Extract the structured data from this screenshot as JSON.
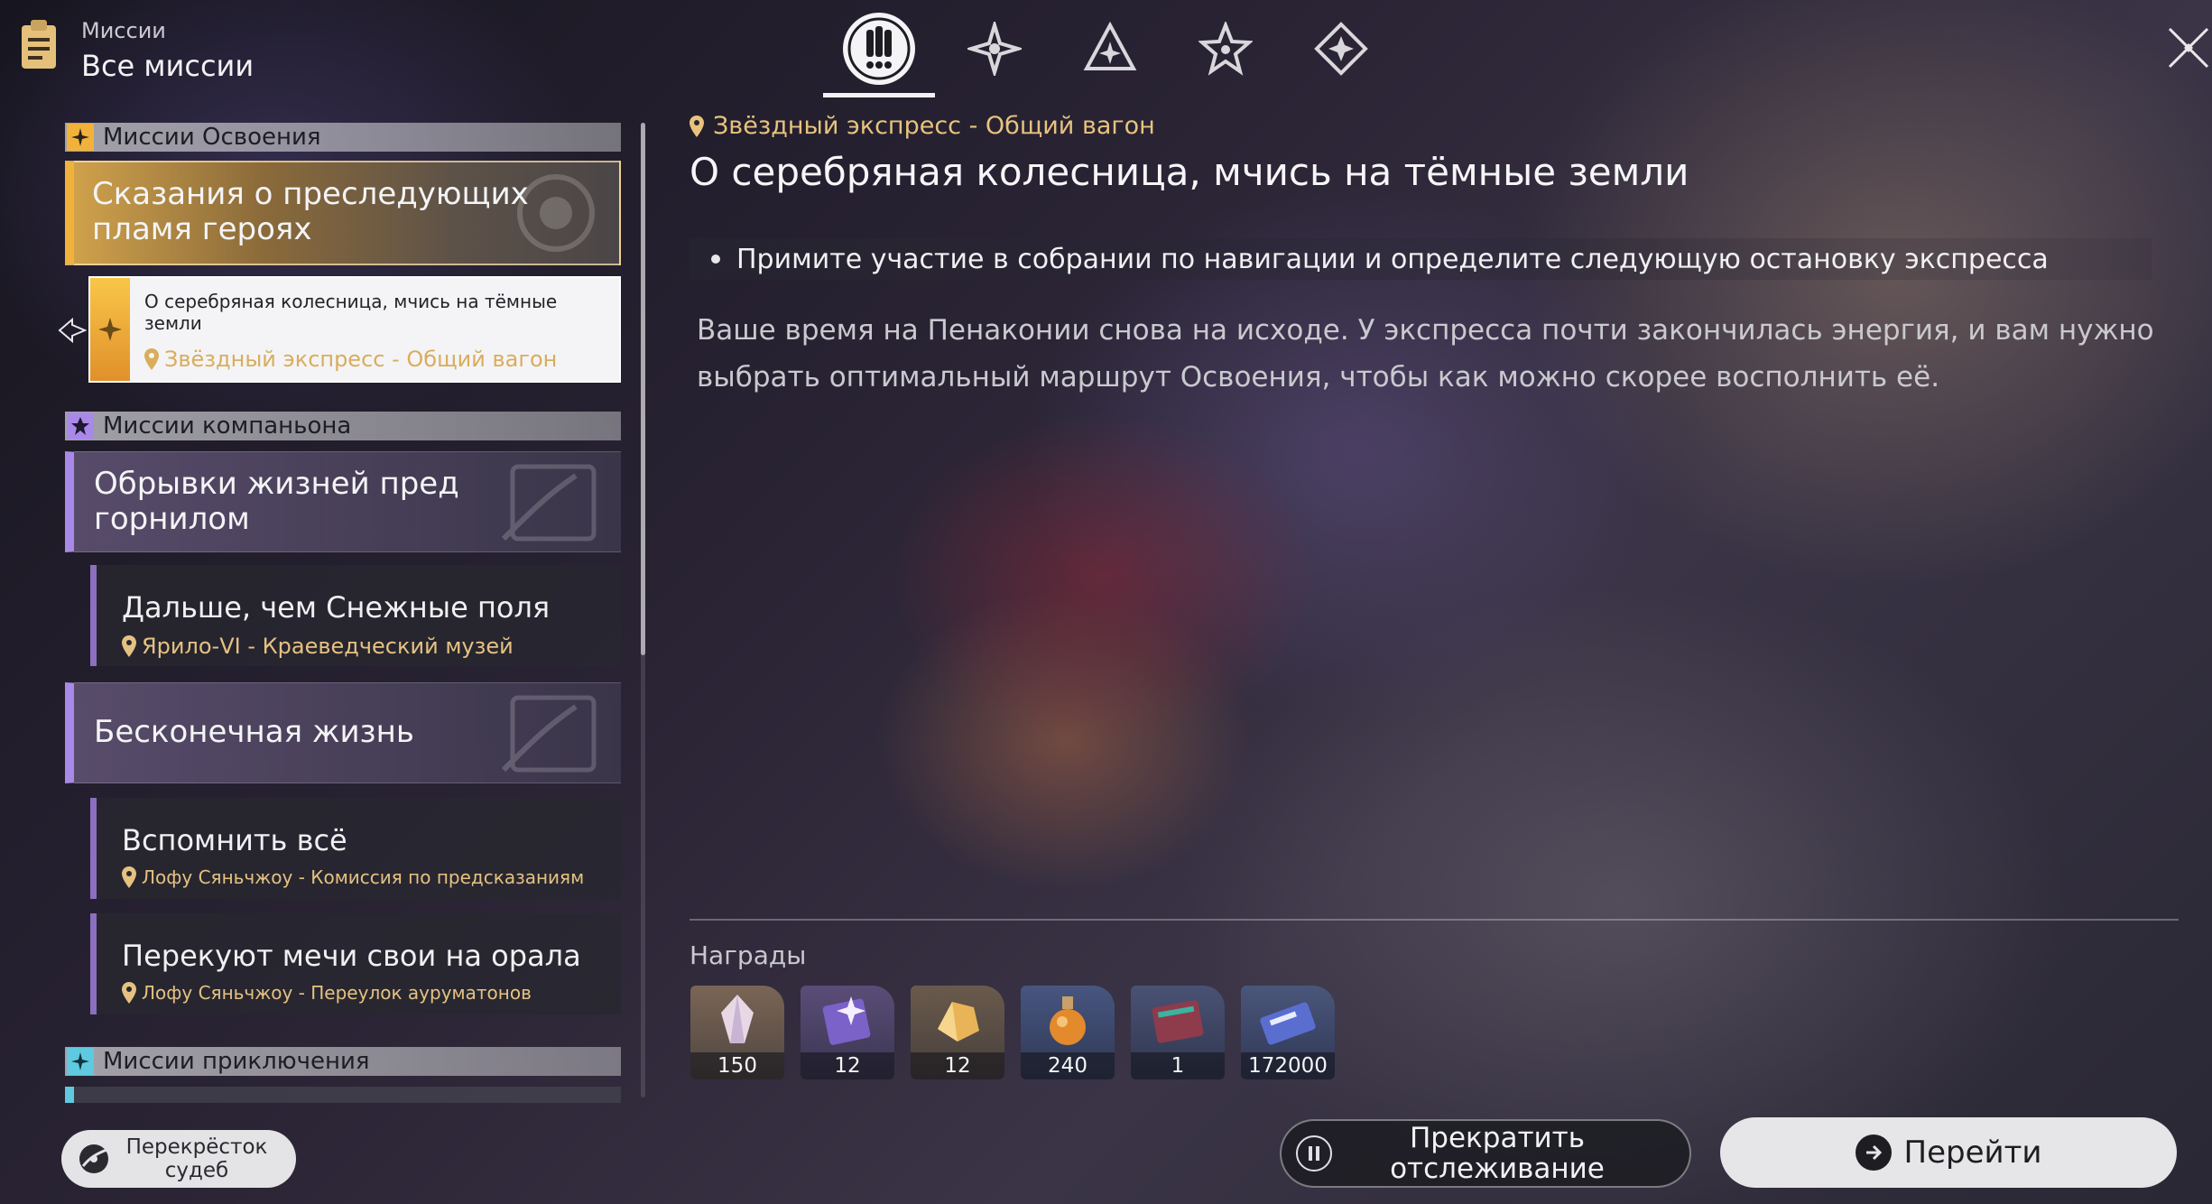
{
  "header": {
    "category": "Миссии",
    "title": "Все миссии",
    "tab_icons": [
      "exclamation-icon",
      "compass-star-icon",
      "triangle-star-icon",
      "five-point-star-icon",
      "diamond-star-icon"
    ],
    "active_tab": 0
  },
  "sidebar": {
    "sections": [
      {
        "label": "Миссии Освоения",
        "color": "#f1b23c"
      },
      {
        "label": "Миссии компаньона",
        "color": "#a989e8"
      },
      {
        "label": "Миссии приключения",
        "color": "#5fc9e0"
      }
    ],
    "trailblaze": {
      "title": "Сказания о преследующих пламя героях",
      "sub": {
        "title": "О серебряная колесница, мчись на тёмные земли",
        "location": "Звёздный экспресс - Общий вагон"
      }
    },
    "companion": [
      {
        "title": "Обрывки жизней пред горнилом",
        "subs": [
          {
            "title": "Дальше, чем Снежные поля",
            "location": "Ярило-VI - Краеведческий музей"
          }
        ]
      },
      {
        "title": "Бесконечная жизнь",
        "subs": [
          {
            "title": "Вспомнить всё",
            "location": "Лофу Сяньчжоу - Комиссия по предсказаниям"
          },
          {
            "title": "Перекуют мечи свои на орала",
            "location": "Лофу Сяньчжоу - Переулок аурума­тонов"
          }
        ]
      }
    ]
  },
  "detail": {
    "location": "Звёздный экспресс - Общий вагон",
    "title": "О серебряная колесница, мчись на тёмные земли",
    "objective": "Примите участие в собрании по навигации и определите следующую остановку экспресса",
    "description": "Ваше время на Пенаконии снова на исходе. У экспресса почти закончилась энергия, и вам нужно выбрать оптимальный маршрут Освоения, чтобы как можно скорее восполнить её.",
    "rewards_label": "Награды",
    "rewards": [
      {
        "count": "150",
        "icon": "stellar-jade-icon",
        "color": "#6c5a4e"
      },
      {
        "count": "12",
        "icon": "purple-book-icon",
        "color": "#4d4265"
      },
      {
        "count": "12",
        "icon": "gold-crystal-icon",
        "color": "#5a4e44"
      },
      {
        "count": "240",
        "icon": "orange-potion-icon",
        "color": "#3c4a6a"
      },
      {
        "count": "1",
        "icon": "red-book-icon",
        "color": "#3e4560"
      },
      {
        "count": "172000",
        "icon": "credit-card-icon",
        "color": "#3d4866"
      }
    ]
  },
  "buttons": {
    "fate": "Перекрёсток\nсудеб",
    "stop": "Прекратить\nотслеживание",
    "go": "Перейти"
  }
}
